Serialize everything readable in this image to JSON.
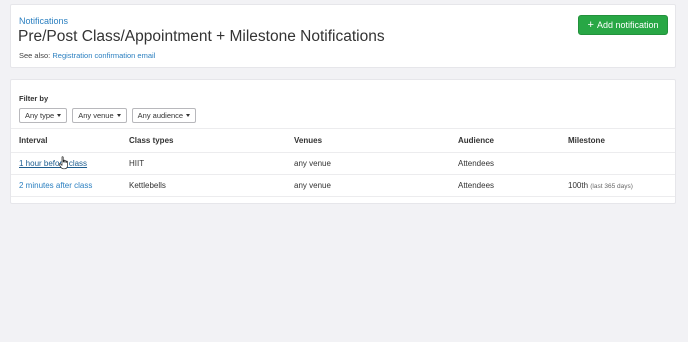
{
  "header": {
    "breadcrumb": "Notifications",
    "title": "Pre/Post Class/Appointment + Milestone Notifications",
    "see_also_label": "See also:",
    "see_also_link": "Registration confirmation email",
    "add_button_icon": "plus-icon",
    "add_button_label": "Add notification",
    "accent_color": "#28a745",
    "link_color": "#2a7fc0"
  },
  "filters": {
    "label": "Filter by",
    "type": "Any type",
    "venue": "Any venue",
    "audience": "Any audience"
  },
  "table": {
    "columns": [
      "Interval",
      "Class types",
      "Venues",
      "Audience",
      "Milestone"
    ],
    "rows": [
      {
        "interval": "1 hour before class",
        "class_types": "HIIT",
        "venues": "any venue",
        "audience": "Attendees",
        "milestone": "",
        "milestone_note": ""
      },
      {
        "interval": "2 minutes after class",
        "class_types": "Kettlebells",
        "venues": "any venue",
        "audience": "Attendees",
        "milestone": "100th",
        "milestone_note": "(last 365 days)"
      }
    ]
  },
  "cursor_icon": "hand-pointer-icon"
}
